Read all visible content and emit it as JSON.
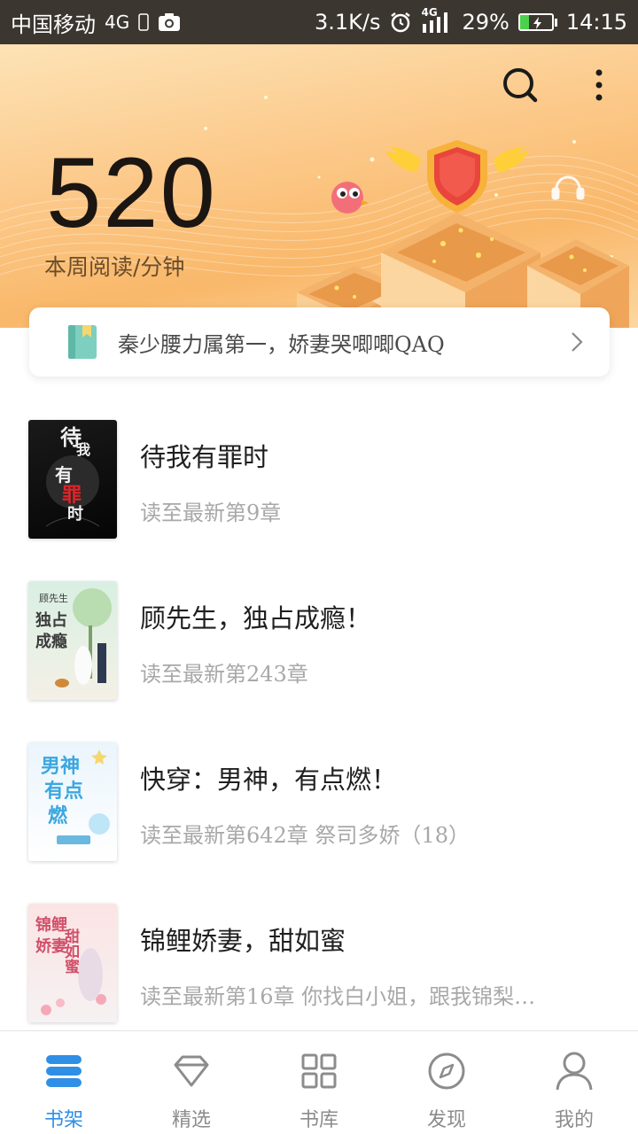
{
  "status_bar": {
    "carrier": "中国移动",
    "network": "4G",
    "speed": "3.1K/s",
    "signal_network": "4G",
    "battery_percent": "29%",
    "battery_level": 0.29,
    "time": "14:15"
  },
  "header": {
    "search_icon": "search-icon",
    "more_icon": "more-vertical-icon",
    "reading_minutes": "520",
    "reading_label": "本周阅读/分钟"
  },
  "continue_reading": {
    "icon": "book-icon",
    "title": "秦少腰力属第一，娇妻哭唧唧QAQ"
  },
  "books": [
    {
      "title": "待我有罪时",
      "progress": "读至最新第9章",
      "cover_text": [
        "待",
        "我",
        "有",
        "罪",
        "时"
      ]
    },
    {
      "title": "顾先生，独占成瘾！",
      "progress": "读至最新第243章",
      "cover_text": [
        "顾先生",
        "独占",
        "成瘾"
      ]
    },
    {
      "title": "快穿：男神，有点燃！",
      "progress": "读至最新第642章 祭司多娇（18）",
      "cover_text": [
        "男神",
        "有点",
        "燃"
      ]
    },
    {
      "title": "锦鲤娇妻，甜如蜜",
      "progress": "读至最新第16章 你找白小姐，跟我锦梨…",
      "cover_text": [
        "锦鲤",
        "娇妻",
        "甜如蜜"
      ]
    }
  ],
  "bottom_nav": {
    "active_color": "#2f8fe6",
    "inactive_color": "#8c8c8c",
    "items": [
      {
        "label": "书架",
        "icon": "bookshelf-icon",
        "active": true
      },
      {
        "label": "精选",
        "icon": "diamond-icon",
        "active": false
      },
      {
        "label": "书库",
        "icon": "grid-icon",
        "active": false
      },
      {
        "label": "发现",
        "icon": "compass-icon",
        "active": false
      },
      {
        "label": "我的",
        "icon": "user-icon",
        "active": false
      }
    ]
  }
}
